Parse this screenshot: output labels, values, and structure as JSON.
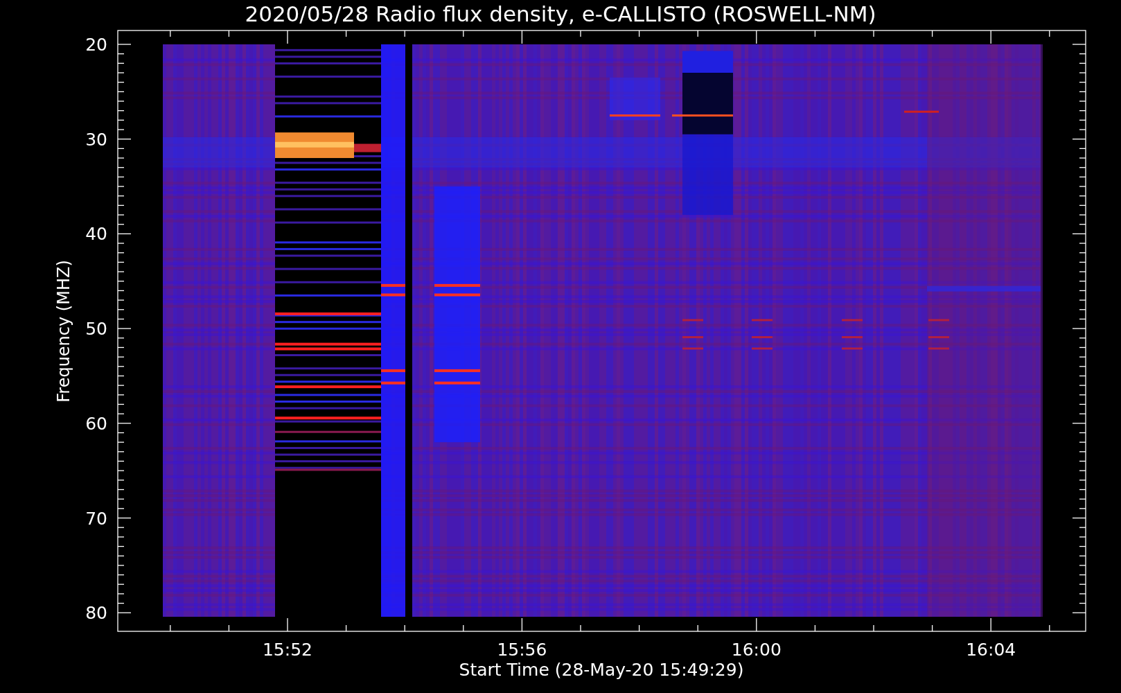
{
  "title": "2020/05/28  Radio flux density, e-CALLISTO (ROSWELL-NM)",
  "y_axis": {
    "label": "Frequency (MHZ)",
    "ticks": [
      "20",
      "30",
      "40",
      "50",
      "60",
      "70",
      "80"
    ]
  },
  "x_axis": {
    "label": "Start Time (28-May-20 15:49:29)",
    "ticks": [
      "15:52",
      "15:56",
      "16:00",
      "16:04"
    ]
  }
}
